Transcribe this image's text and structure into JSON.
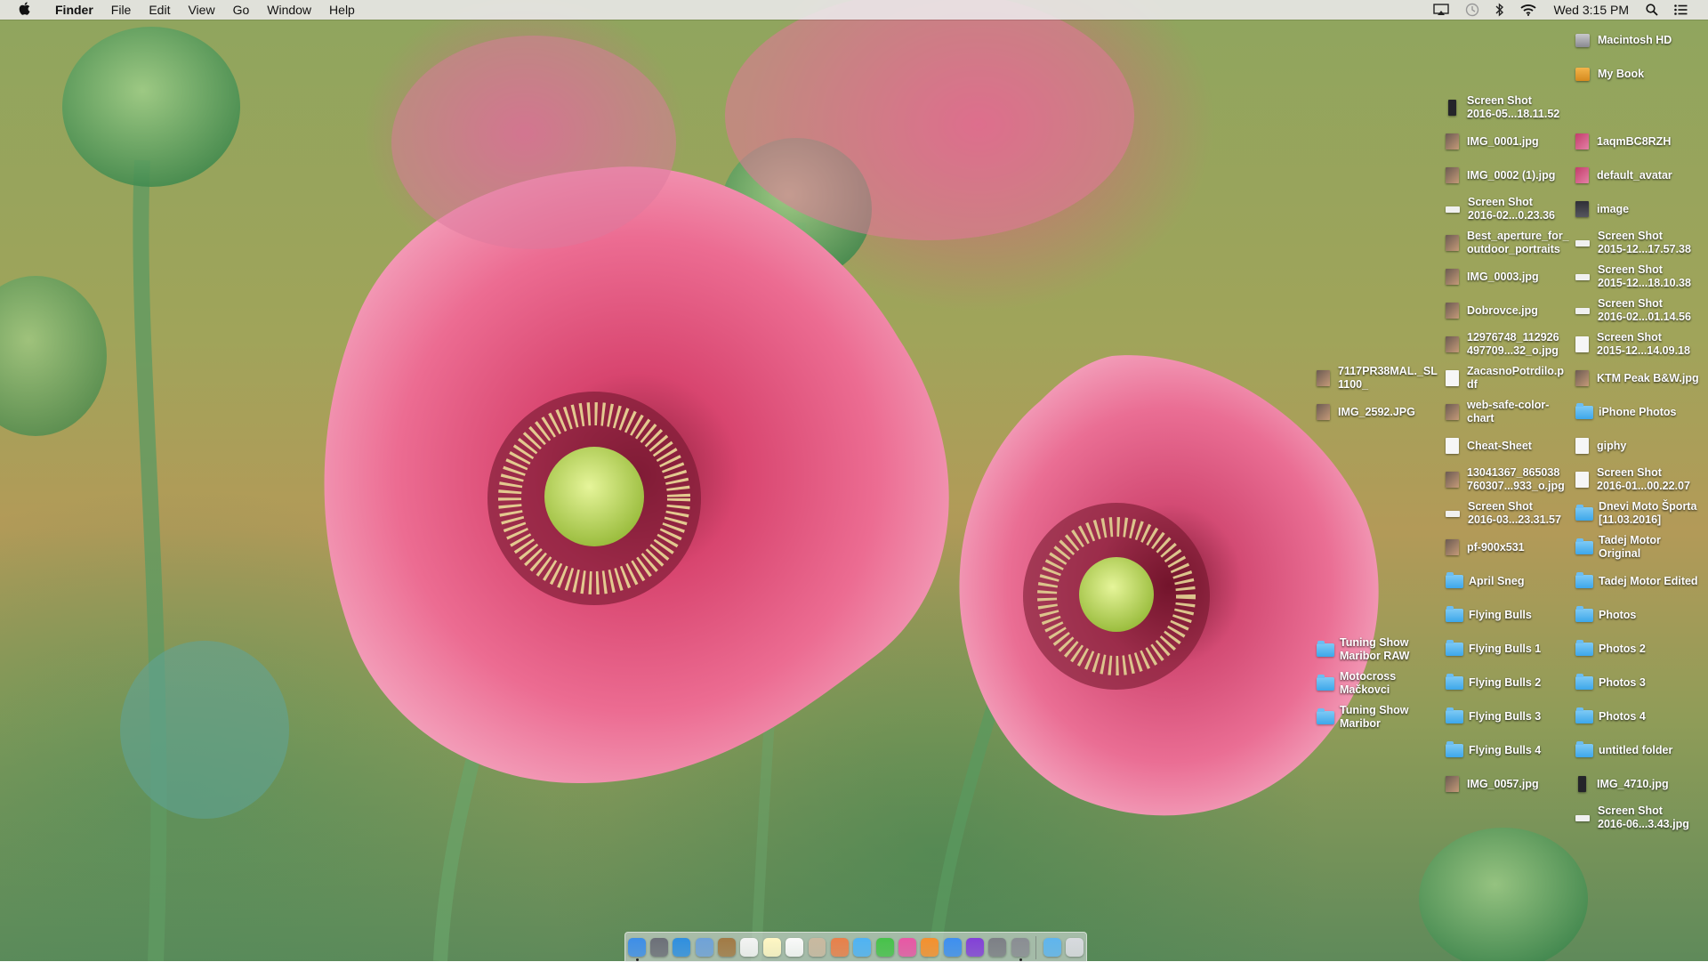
{
  "menubar": {
    "app_name": "Finder",
    "menus": [
      "File",
      "Edit",
      "View",
      "Go",
      "Window",
      "Help"
    ],
    "status_icons": [
      "airplay-icon",
      "time-machine-icon",
      "bluetooth-icon",
      "wifi-icon"
    ],
    "clock": "Wed 3:15 PM"
  },
  "desktop": {
    "column_right": [
      {
        "label": "Macintosh HD",
        "icon": "drive"
      },
      {
        "label": "My Book",
        "icon": "ext"
      },
      {
        "label": "1aqmBC8RZH",
        "icon": "img2"
      },
      {
        "label": "default_avatar",
        "icon": "img2"
      },
      {
        "label": "image",
        "icon": "dark"
      },
      {
        "label": "Screen Shot\n2015-12...17.57.38",
        "icon": "shot"
      },
      {
        "label": "Screen Shot\n2015-12...18.10.38",
        "icon": "shot"
      },
      {
        "label": "Screen Shot\n2016-02...01.14.56",
        "icon": "shot"
      },
      {
        "label": "Screen Shot\n2015-12...14.09.18",
        "icon": "doc"
      },
      {
        "label": "KTM Peak B&W.jpg",
        "icon": "img"
      },
      {
        "label": "iPhone Photos",
        "icon": "folder"
      },
      {
        "label": "giphy",
        "icon": "doc"
      },
      {
        "label": "Screen Shot\n2016-01...00.22.07",
        "icon": "doc"
      },
      {
        "label": "Dnevi Moto Športa\n[11.03.2016]",
        "icon": "folder"
      },
      {
        "label": "Tadej Motor\nOriginal",
        "icon": "folder"
      },
      {
        "label": "Tadej Motor Edited",
        "icon": "folder"
      },
      {
        "label": "Photos",
        "icon": "folder"
      },
      {
        "label": "Photos 2",
        "icon": "folder"
      },
      {
        "label": "Photos 3",
        "icon": "folder"
      },
      {
        "label": "Photos 4",
        "icon": "folder"
      },
      {
        "label": "untitled folder",
        "icon": "folder"
      },
      {
        "label": "IMG_4710.jpg",
        "icon": "phone"
      },
      {
        "label": "Screen Shot\n2016-06...3.43.jpg",
        "icon": "shot"
      }
    ],
    "column_middle": [
      {
        "label": "Screen Shot\n2016-05...18.11.52",
        "icon": "phone"
      },
      {
        "label": "IMG_0001.jpg",
        "icon": "img"
      },
      {
        "label": "IMG_0002 (1).jpg",
        "icon": "img"
      },
      {
        "label": "Screen Shot\n2016-02...0.23.36",
        "icon": "shot"
      },
      {
        "label": "Best_aperture_for_\noutdoor_portraits",
        "icon": "img"
      },
      {
        "label": "IMG_0003.jpg",
        "icon": "img"
      },
      {
        "label": "Dobrovce.jpg",
        "icon": "img"
      },
      {
        "label": "12976748_112926\n497709...32_o.jpg",
        "icon": "img"
      },
      {
        "label": "ZacasnoPotrdilo.p\ndf",
        "icon": "doc"
      },
      {
        "label": "web-safe-color-\nchart",
        "icon": "img"
      },
      {
        "label": "Cheat-Sheet",
        "icon": "doc"
      },
      {
        "label": "13041367_865038\n760307...933_o.jpg",
        "icon": "img"
      },
      {
        "label": "Screen Shot\n2016-03...23.31.57",
        "icon": "shot"
      },
      {
        "label": "pf-900x531",
        "icon": "img"
      },
      {
        "label": "April Sneg",
        "icon": "folder"
      },
      {
        "label": "Flying Bulls",
        "icon": "folder"
      },
      {
        "label": "Flying Bulls 1",
        "icon": "folder"
      },
      {
        "label": "Flying Bulls 2",
        "icon": "folder"
      },
      {
        "label": "Flying Bulls 3",
        "icon": "folder"
      },
      {
        "label": "Flying Bulls 4",
        "icon": "folder"
      },
      {
        "label": "IMG_0057.jpg",
        "icon": "img"
      }
    ],
    "column_left_top": [
      {
        "label": "7117PR38MAL._SL\n1100_",
        "icon": "img"
      },
      {
        "label": "IMG_2592.JPG",
        "icon": "img"
      }
    ],
    "column_left_bottom": [
      {
        "label": "Tuning Show\nMaribor RAW",
        "icon": "folder"
      },
      {
        "label": "Motocross\nMačkovci",
        "icon": "folder"
      },
      {
        "label": "Tuning Show\nMaribor",
        "icon": "folder"
      }
    ]
  },
  "dock": {
    "apps": [
      {
        "name": "finder",
        "color": "#3d8ee8",
        "running": true
      },
      {
        "name": "launchpad",
        "color": "#6c6f78",
        "running": false
      },
      {
        "name": "safari",
        "color": "#2f8fe0",
        "running": false
      },
      {
        "name": "mail",
        "color": "#6fa2d8",
        "running": false
      },
      {
        "name": "notebook",
        "color": "#a27a45",
        "running": false
      },
      {
        "name": "calendar",
        "color": "#f4f4f4",
        "running": false
      },
      {
        "name": "notes",
        "color": "#fff7c4",
        "running": false
      },
      {
        "name": "reminders",
        "color": "#fafafa",
        "running": false
      },
      {
        "name": "photos-preview",
        "color": "#c9b9a0",
        "running": false
      },
      {
        "name": "photos",
        "color": "#e9804a",
        "running": false
      },
      {
        "name": "messages",
        "color": "#4fb3f4",
        "running": false
      },
      {
        "name": "facetime",
        "color": "#47c24a",
        "running": false
      },
      {
        "name": "itunes",
        "color": "#e857a5",
        "running": false
      },
      {
        "name": "ibooks",
        "color": "#f5902d",
        "running": false
      },
      {
        "name": "app-store",
        "color": "#3d8ff0",
        "running": false
      },
      {
        "name": "affinity",
        "color": "#8340d8",
        "running": false
      },
      {
        "name": "system-preferences",
        "color": "#7d7f86",
        "running": false
      },
      {
        "name": "automator",
        "color": "#8a8d93",
        "running": true
      }
    ],
    "extras": [
      {
        "name": "downloads-folder",
        "color": "#5fb5ee"
      },
      {
        "name": "trash",
        "color": "#d8dadf"
      }
    ]
  }
}
